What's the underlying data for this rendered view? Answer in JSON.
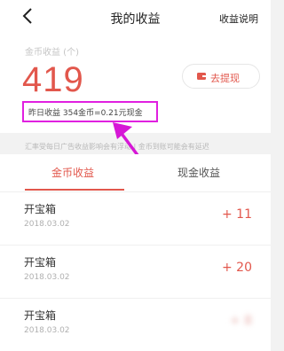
{
  "header": {
    "title": "我的收益",
    "help_label": "收益说明"
  },
  "summary": {
    "coin_label": "金币收益 (个)",
    "amount": "419",
    "withdraw_label": "去提现",
    "yesterday": "昨日收益 354金币=0.21元现金"
  },
  "notice": "汇率受每日广告收益影响会有浮动 | 金币到账可能会有延迟",
  "tabs": [
    {
      "label": "金币收益",
      "active": true
    },
    {
      "label": "现金收益",
      "active": false
    }
  ],
  "records": [
    {
      "title": "开宝箱",
      "date": "2018.03.02",
      "amount": "+ 11"
    },
    {
      "title": "开宝箱",
      "date": "2018.03.02",
      "amount": "+ 20"
    },
    {
      "title": "开宝箱",
      "date": "2018.03.02",
      "amount": "+ 8"
    }
  ],
  "colors": {
    "accent": "#e2574c",
    "highlight": "#e020e0"
  }
}
